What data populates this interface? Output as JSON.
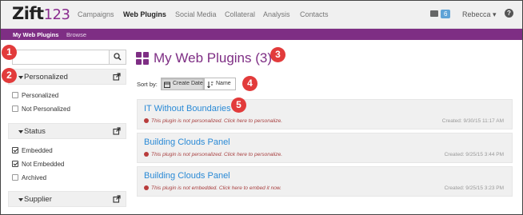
{
  "nav": {
    "logo_main": "Zift",
    "logo_num": "123",
    "items": [
      "Campaigns",
      "Web Plugins",
      "Social Media",
      "Collateral",
      "Analysis",
      "Contacts"
    ],
    "active": "Web Plugins",
    "mail_count": "6",
    "user": "Rebecca ▾",
    "help": "?"
  },
  "subnav": {
    "items": [
      "My Web Plugins",
      "Browse"
    ]
  },
  "sidebar": {
    "search_placeholder": "",
    "groups": [
      {
        "label": "Personalized",
        "options": [
          {
            "label": "Personalized",
            "checked": false
          },
          {
            "label": "Not Personalized",
            "checked": false
          }
        ]
      },
      {
        "label": "Status",
        "options": [
          {
            "label": "Embedded",
            "checked": true
          },
          {
            "label": "Not Embedded",
            "checked": true
          },
          {
            "label": "Archived",
            "checked": false
          }
        ]
      },
      {
        "label": "Supplier",
        "options": []
      }
    ]
  },
  "main": {
    "title": "My Web Plugins (3)",
    "sort_label": "Sort by:",
    "sort_options": [
      "Create Date",
      "Name"
    ],
    "sort_active": "Create Date",
    "plugins": [
      {
        "title": "IT Without Boundaries",
        "message": "This plugin is not personalized. Click here to personalize.",
        "created": "Created: 9/30/15 11:17 AM"
      },
      {
        "title": "Building Clouds Panel",
        "message": "This plugin is not personalized. Click here to personalize.",
        "created": "Created: 9/25/15 3:44 PM"
      },
      {
        "title": "Building Clouds Panel",
        "message": "This plugin is not embedded. Click here to embed it now.",
        "created": "Created: 9/25/15 3:23 PM"
      }
    ]
  },
  "callouts": [
    "1",
    "2",
    "3",
    "4",
    "5"
  ],
  "colors": {
    "brand": "#7e2e84",
    "link": "#2a8ad6",
    "callout": "#e23b3b",
    "warning": "#a84040"
  }
}
